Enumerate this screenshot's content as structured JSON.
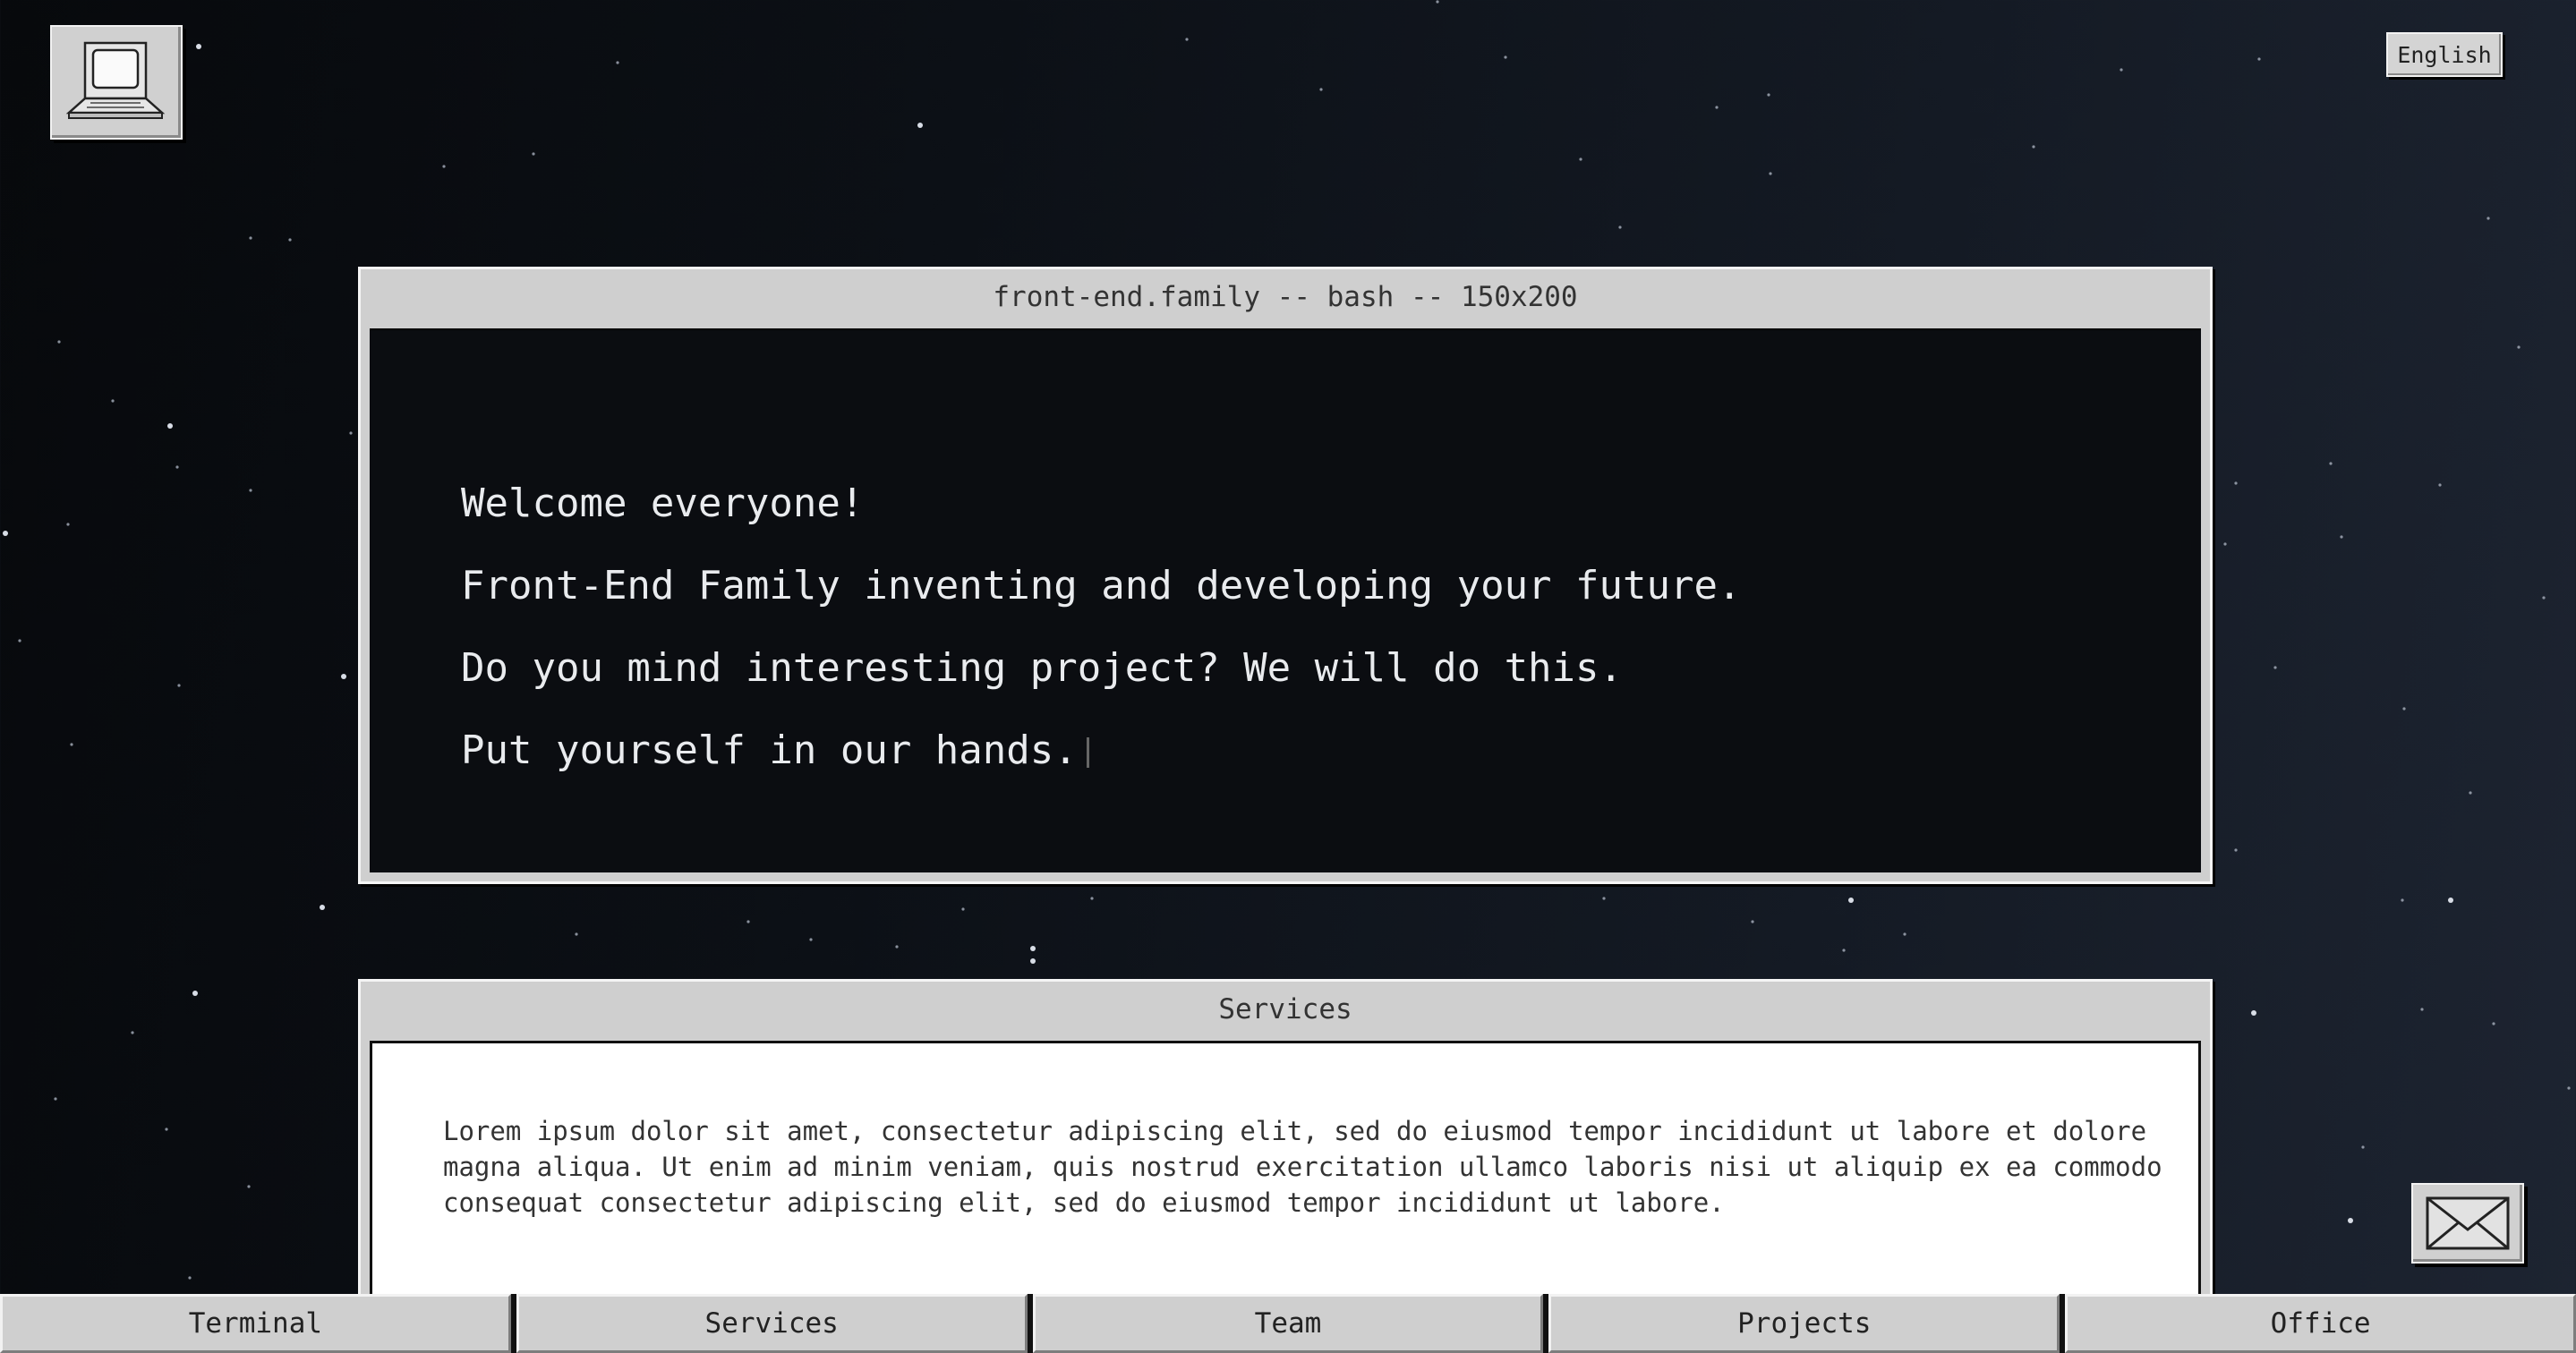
{
  "top_bar": {
    "language_label": "English",
    "computer_icon": "computer-icon"
  },
  "terminal": {
    "title": "front-end.family -- bash -- 150x200",
    "lines": [
      "Welcome everyone!",
      "Front-End Family inventing and developing your future.",
      "Do you mind interesting project? We will do this.",
      "Put yourself in our hands."
    ]
  },
  "services": {
    "title": "Services",
    "text": "Lorem ipsum dolor sit amet, consectetur adipiscing elit, sed do eiusmod tempor incididunt ut labore et dolore magna aliqua. Ut enim ad minim veniam, quis nostrud exercitation ullamco laboris nisi ut aliquip ex ea commodo consequat consectetur adipiscing elit, sed do eiusmod tempor incididunt ut labore."
  },
  "mail": {
    "icon": "mail-icon"
  },
  "bottom_nav": {
    "tabs": [
      {
        "label": "Terminal"
      },
      {
        "label": "Services"
      },
      {
        "label": "Team"
      },
      {
        "label": "Projects"
      },
      {
        "label": "Office"
      }
    ]
  },
  "colors": {
    "window_chrome": "#cfcfcf",
    "terminal_bg": "#0b0d11",
    "terminal_text": "#e9ebee",
    "background_dark": "#07090c",
    "background_light": "#1d2431"
  }
}
